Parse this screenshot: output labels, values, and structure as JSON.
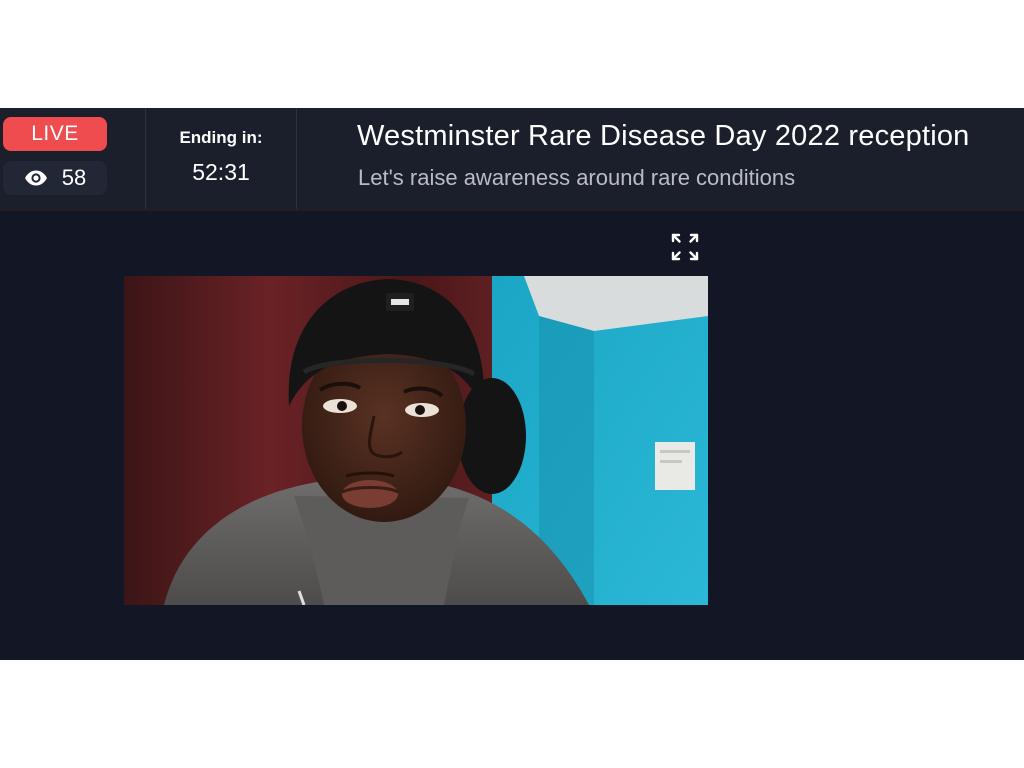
{
  "status": {
    "live_label": "LIVE",
    "viewer_count": "58",
    "viewer_icon": "eye-icon"
  },
  "timer": {
    "label": "Ending in:",
    "value": "52:31"
  },
  "event": {
    "title": "Westminster Rare Disease Day 2022 reception",
    "subtitle": "Let's raise awareness around rare conditions"
  },
  "controls": {
    "expand_icon": "fullscreen-expand-icon"
  },
  "colors": {
    "live_red": "#ef4c4f",
    "header_bg": "#1b1f2c",
    "page_bg": "#131624"
  }
}
